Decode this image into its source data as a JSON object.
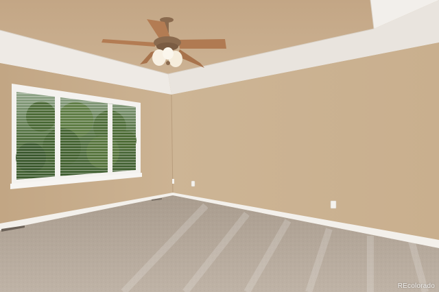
{
  "watermark": {
    "text": "REcolorado"
  },
  "colors": {
    "ceiling": "#c4a98a",
    "tray_trim": "#ece7e1",
    "left_wall": "#c7ad8c",
    "right_wall": "#cfb797",
    "carpet": "#b4a89a",
    "baseboard": "#f2efea",
    "window_frame": "#f3f1ee",
    "foliage": "#3d5a2e",
    "fan_wood": "#b07a52",
    "fan_metal": "#8a6a4e",
    "fan_light": "#f7efe0"
  }
}
